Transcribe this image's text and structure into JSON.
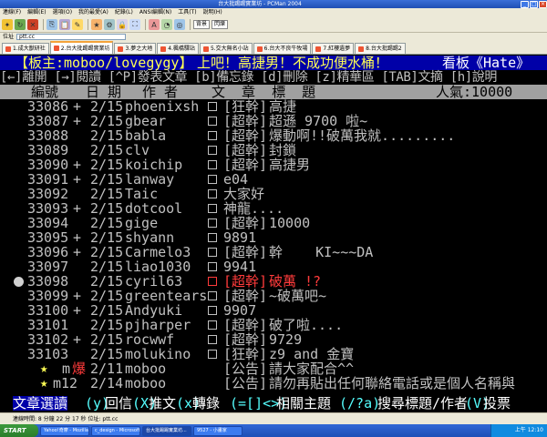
{
  "window": {
    "title": "台大批踢踢實業坊 - PCMan 2004"
  },
  "menu": [
    "連線(F)",
    "編輯(E)",
    "選項(O)",
    "我的最愛(A)",
    "紀錄(L)",
    "ANSI編輯(N)",
    "工具(T)",
    "說明(H)"
  ],
  "toolbar": {
    "text_buttons": [
      "背景",
      "閃爍"
    ]
  },
  "address": {
    "label": "位址",
    "value": "ptt.cc"
  },
  "tabs": [
    "1.成大獸研社",
    "2.台大批踢踢實業坊",
    "3.夢之大地",
    "4.楓橋驛站",
    "5.交大無名小站",
    "6.台大不良牛牧場",
    "7.紅樓遺夢",
    "8.台大批踢踢2"
  ],
  "term": {
    "header_left": "【板主:moboo/lovegygy】",
    "header_mid": "上吧！高捷男！不成功便水桶！",
    "header_right": "看板《Hate》",
    "help_line": "[←]離開 [→]閱讀 [^P]發表文章 [b]備忘錄 [d]刪除 [z]精華區 [TAB]文摘 [h]說明",
    "col_no": "編號",
    "col_date": "日 期",
    "col_author": "作 者",
    "col_title": "文  章  標  題",
    "popularity": "人氣:10000",
    "rows": [
      {
        "no": "33086",
        "mark": "+",
        "date": "2/15",
        "author": "phoenixsh",
        "tag": "[狂幹]",
        "title": "高捷"
      },
      {
        "no": "33087",
        "mark": "+",
        "date": "2/15",
        "author": "gbear",
        "tag": "[超幹]",
        "title": "超遜 9700 啦~"
      },
      {
        "no": "33088",
        "mark": "",
        "date": "2/15",
        "author": "babla",
        "tag": "[超幹]",
        "title": "爆動啊!!破萬我就........."
      },
      {
        "no": "33089",
        "mark": "",
        "date": "2/15",
        "author": "clv",
        "tag": "[超幹]",
        "title": "封鎖"
      },
      {
        "no": "33090",
        "mark": "+",
        "date": "2/15",
        "author": "koichip",
        "tag": "[超幹]",
        "title": "高捷男"
      },
      {
        "no": "33091",
        "mark": "+",
        "date": "2/15",
        "author": "lanway",
        "tag": "",
        "title": "e04"
      },
      {
        "no": "33092",
        "mark": "",
        "date": "2/15",
        "author": "Taic",
        "tag": "",
        "title": "大家好"
      },
      {
        "no": "33093",
        "mark": "+",
        "date": "2/15",
        "author": "dotcool",
        "tag": "",
        "title": "神龍...."
      },
      {
        "no": "33094",
        "mark": "",
        "date": "2/15",
        "author": "gige",
        "tag": "[超幹]",
        "title": "10000"
      },
      {
        "no": "33095",
        "mark": "+",
        "date": "2/15",
        "author": "shyann",
        "tag": "",
        "title": "9891"
      },
      {
        "no": "33096",
        "mark": "+",
        "date": "2/15",
        "author": "Carmelo3",
        "tag": "[超幹]",
        "title": "幹    KI~~~DA"
      },
      {
        "no": "33097",
        "mark": "",
        "date": "2/15",
        "author": "liao1030",
        "tag": "",
        "title": "9941"
      },
      {
        "no": "33098",
        "mark": "",
        "date": "2/15",
        "author": "cyril63",
        "tag": "[超幹]",
        "title": "破萬 !?"
      },
      {
        "no": "33099",
        "mark": "+",
        "date": "2/15",
        "author": "greentears",
        "tag": "[超幹]",
        "title": "~破萬吧~"
      },
      {
        "no": "33100",
        "mark": "+",
        "date": "2/15",
        "author": "Andyuki",
        "tag": "",
        "title": "9907"
      },
      {
        "no": "33101",
        "mark": "",
        "date": "2/15",
        "author": "pjharper",
        "tag": "[超幹]",
        "title": "破了啦...."
      },
      {
        "no": "33102",
        "mark": "+",
        "date": "2/15",
        "author": "rocwwf",
        "tag": "[超幹]",
        "title": "9729"
      },
      {
        "no": "33103",
        "mark": "",
        "date": "2/15",
        "author": "molukino",
        "tag": "[狂幹]",
        "title": "z9 and 金寶"
      },
      {
        "no": "m",
        "mark": "爆",
        "date": "2/11",
        "author": "moboo",
        "tag": "[公告]",
        "title": "請大家配合^^"
      },
      {
        "no": "m12",
        "mark": "",
        "date": "2/14",
        "author": "moboo",
        "tag": "[公告]",
        "title": "請勿再貼出任何聯絡電話或是個人名稱與"
      }
    ],
    "footer": {
      "mode": "文章選讀",
      "k1": "(y)",
      "v1": "回信",
      "k2": "(X)",
      "v2": "推文",
      "k3": "(x)",
      "v3": "轉錄",
      "k4": "(=[]<>)",
      "v4": "相關主題",
      "k5": "(/?a)",
      "v5": "搜尋標題/作者",
      "k6": "(V)",
      "v6": "投票"
    }
  },
  "status": {
    "text": "連線時間: 8 分鐘 22 分 17 秒    位址: ptt.cc"
  },
  "taskbar": {
    "start": "START",
    "tasks": [
      "Yahoo!奇摩 - Mozilla...",
      "c_design - Microsoft...",
      "台大批踢踢實業坊...",
      "9527 - 小畫家"
    ],
    "clock": "上午 12:10"
  },
  "colors": {
    "header_bg": "#0000a8",
    "yellow": "#ffff55",
    "red": "#ff3b3b",
    "gray": "#c0c0c0"
  }
}
